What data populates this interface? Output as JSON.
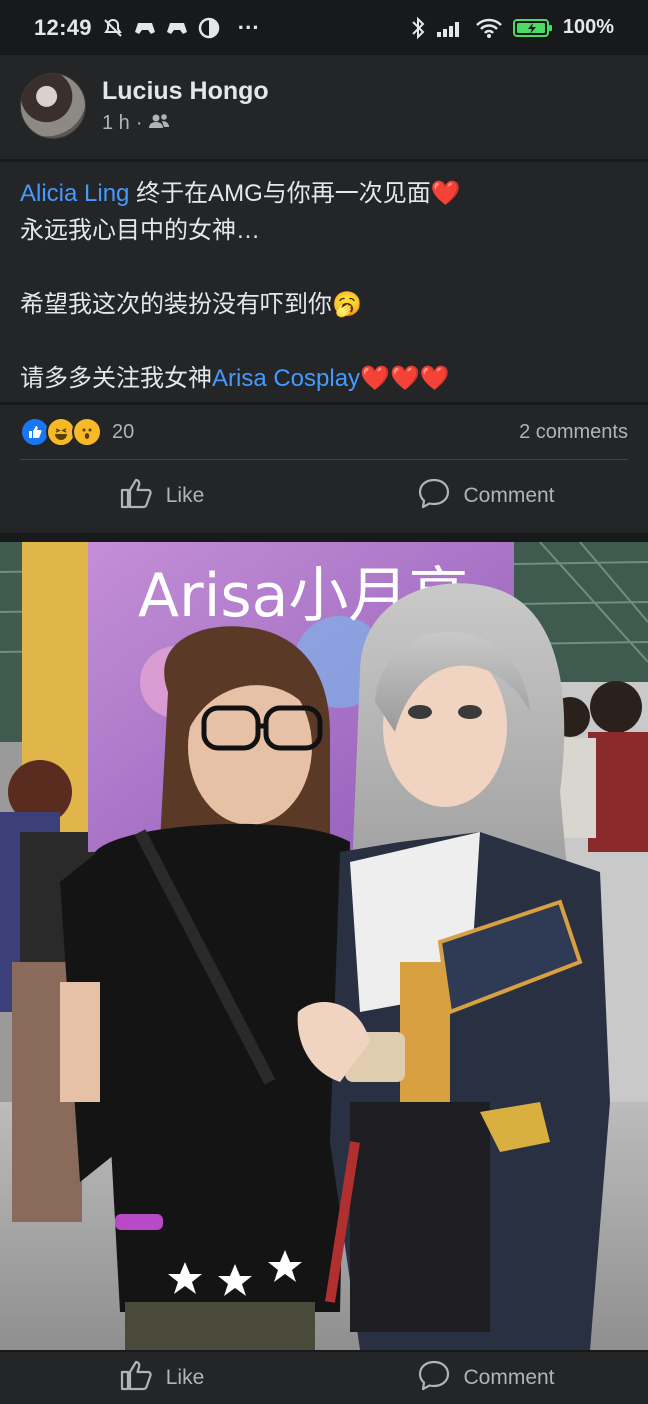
{
  "status_bar": {
    "time": "12:49",
    "more": "···",
    "battery": "100%",
    "icons": [
      "mute-bell-icon",
      "game-icon",
      "game-icon",
      "data-saver-icon",
      "bluetooth-icon",
      "signal-icon",
      "wifi-icon",
      "battery-icon"
    ]
  },
  "post": {
    "author": "Lucius Hongo",
    "time": "1 h",
    "separator": "·",
    "privacy_icon": "friends-icon",
    "text": {
      "mention1": "Alicia Ling",
      "line1_rest": " 终于在AMG与你再一次见面",
      "heart": "❤️",
      "line2": "永远我心目中的女神…",
      "line3": "希望我这次的装扮没有吓到你",
      "yawn": "🥱",
      "line4_prefix": "请多多关注我女神",
      "mention2": "Arisa Cosplay",
      "hearts": "❤️❤️❤️"
    },
    "reactions": {
      "icons": [
        "like-reaction-icon",
        "haha-reaction-icon",
        "wow-reaction-icon"
      ],
      "count": "20",
      "comments": "2 comments"
    },
    "actions": {
      "like": "Like",
      "comment": "Comment"
    }
  },
  "photo": {
    "banner_text": "Arisa小月亮"
  },
  "bottom_actions": {
    "like": "Like",
    "comment": "Comment"
  },
  "colors": {
    "background": "#18191a",
    "card": "#242526",
    "mention": "#4599ff",
    "heart": "#f02849",
    "like_blue": "#1877f2"
  }
}
